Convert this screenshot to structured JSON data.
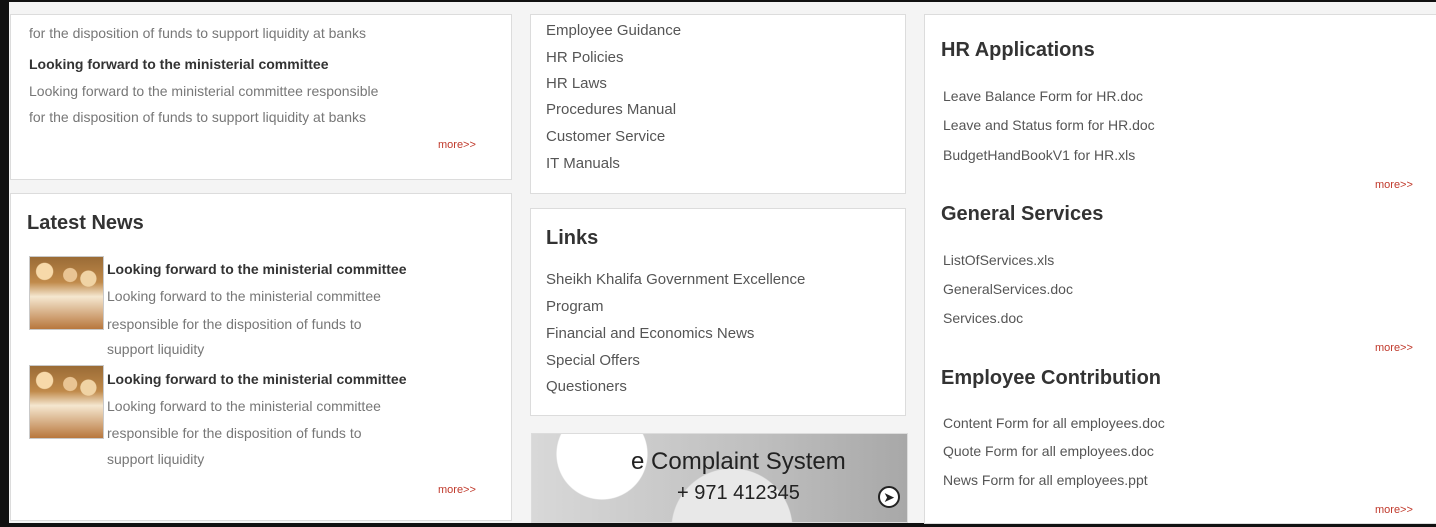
{
  "top_left": {
    "line1": "for the disposition of funds to support liquidity at banks",
    "headline": "Looking forward to the ministerial committee",
    "desc_line1": "Looking forward to the ministerial committee responsible",
    "desc_line2": "for the disposition of funds to support liquidity at banks",
    "more": "more>>"
  },
  "latest_news": {
    "title": "Latest News",
    "items": [
      {
        "headline": "Looking forward to the ministerial committee",
        "l1": "Looking forward to the ministerial committee",
        "l2": "responsible for the disposition of funds to",
        "l3": "support liquidity"
      },
      {
        "headline": "Looking forward to the ministerial committee",
        "l1": "Looking forward to the ministerial committee",
        "l2": "responsible for the disposition of funds to",
        "l3": "support liquidity"
      }
    ],
    "more": "more>>"
  },
  "guides": {
    "items": [
      "Employee Guidance",
      "HR Policies",
      "HR Laws",
      "Procedures Manual",
      "Customer Service",
      "IT Manuals"
    ]
  },
  "links": {
    "title": "Links",
    "items": [
      "Sheikh Khalifa Government Excellence",
      "Program",
      "Financial and Economics News",
      "Special Offers",
      "Questioners"
    ]
  },
  "banner": {
    "title": "e Complaint System",
    "phone": "+ 971 412345"
  },
  "hr_applications": {
    "title": "HR Applications",
    "items": [
      "Leave Balance Form for HR.doc",
      "Leave and Status form for HR.doc",
      "BudgetHandBookV1 for HR.xls"
    ],
    "more": "more>>"
  },
  "general_services": {
    "title": "General Services",
    "items": [
      "ListOfServices.xls",
      "GeneralServices.doc",
      "Services.doc"
    ],
    "more": "more>>"
  },
  "employee_contribution": {
    "title": "Employee Contribution",
    "items": [
      "Content Form for all employees.doc",
      "Quote Form for all employees.doc",
      "News Form for all employees.ppt"
    ],
    "more": "more>>"
  }
}
